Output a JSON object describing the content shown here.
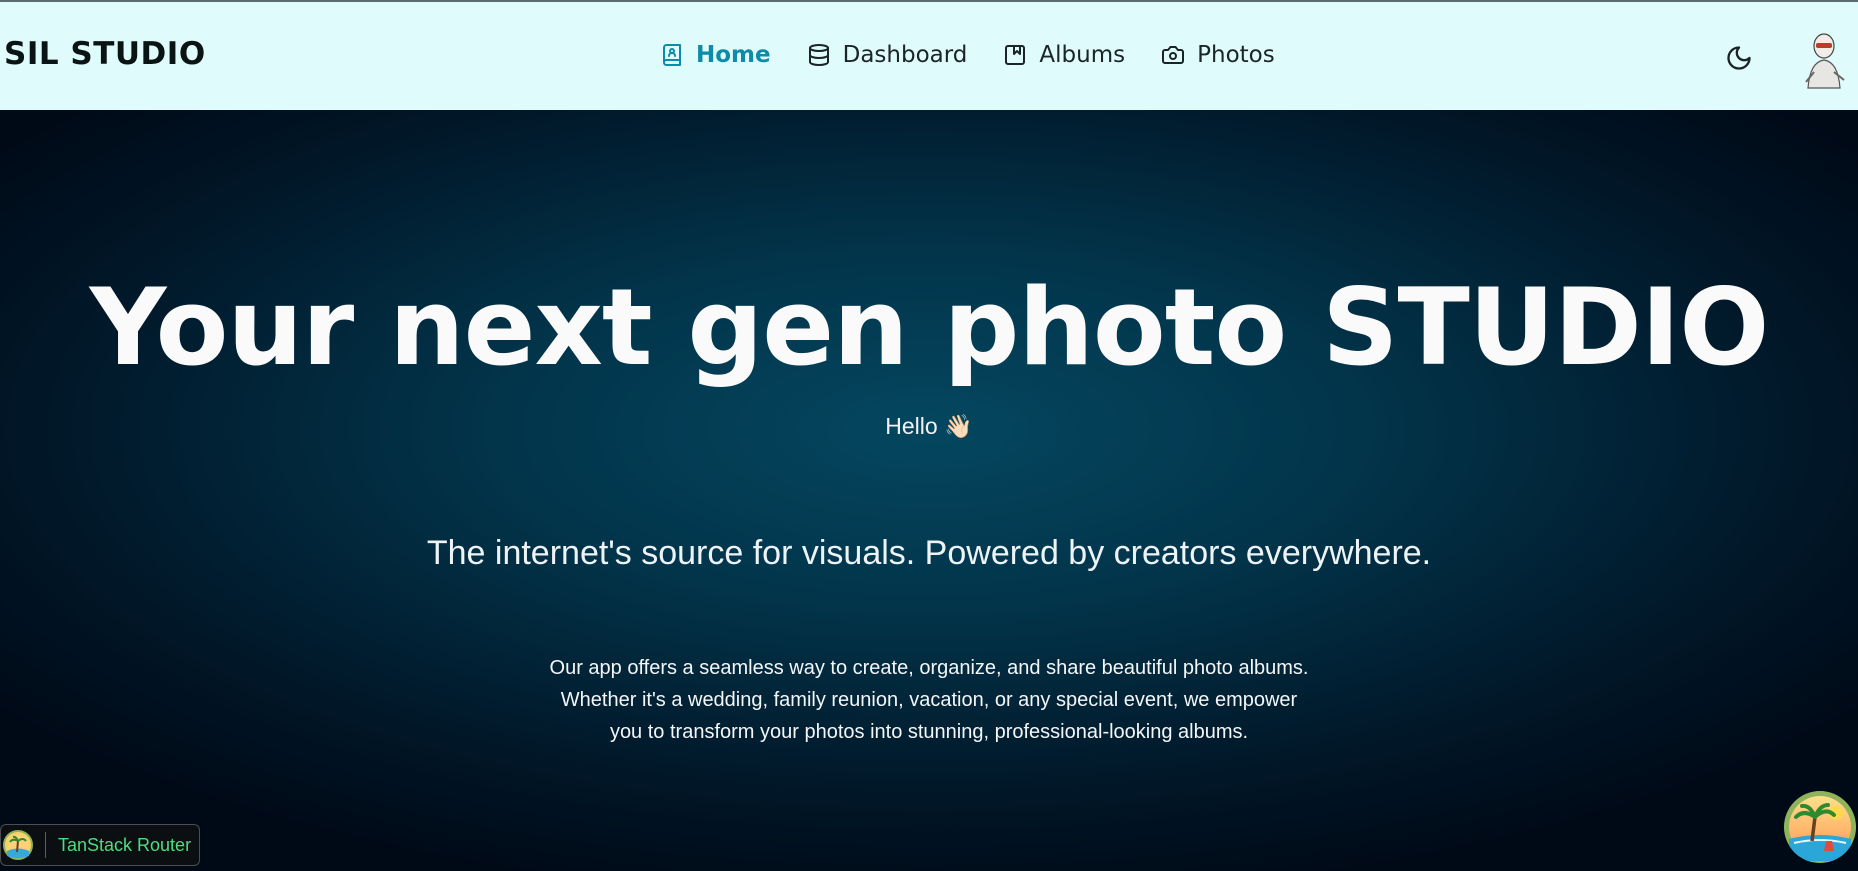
{
  "navbar": {
    "brand": "SIL STUDIO",
    "links": [
      {
        "label": "Home",
        "icon": "book-user-icon",
        "active": true
      },
      {
        "label": "Dashboard",
        "icon": "database-icon",
        "active": false
      },
      {
        "label": "Albums",
        "icon": "album-icon",
        "active": false
      },
      {
        "label": "Photos",
        "icon": "camera-icon",
        "active": false
      }
    ],
    "theme_toggle_icon": "moon-icon",
    "avatar_icon": "user-avatar"
  },
  "hero": {
    "title": "Your next gen photo STUDIO",
    "greeting": "Hello 👋🏻",
    "tagline": "The internet's source for visuals. Powered by creators everywhere.",
    "description": "Our app offers a seamless way to create, organize, and share beautiful photo albums. Whether it's a wedding, family reunion, vacation, or any special event, we empower you to transform your photos into stunning, professional-looking albums."
  },
  "devtools": {
    "label": "TanStack Router",
    "icon": "tanstack-palm-logo"
  },
  "floating_button": {
    "icon": "tanstack-palm-logo"
  },
  "colors": {
    "navbar_bg": "#e0fbfc",
    "active_link": "#0e8ba8",
    "hero_center": "#044760",
    "hero_edge": "#000a17",
    "devtools_label": "#4ade80"
  }
}
